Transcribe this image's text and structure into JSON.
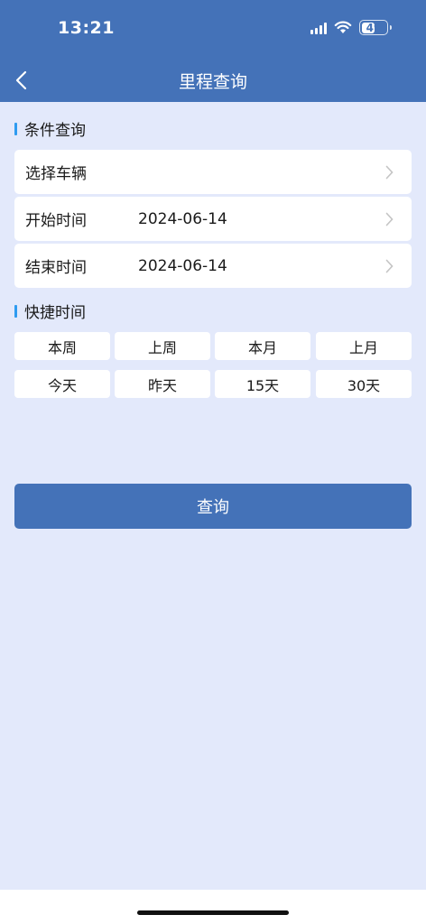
{
  "status_bar": {
    "time": "13:21",
    "battery": "49"
  },
  "nav": {
    "title": "里程查询"
  },
  "conditions": {
    "section_title": "条件查询",
    "vehicle_label": "选择车辆",
    "start_label": "开始时间",
    "start_value": "2024-06-14",
    "end_label": "结束时间",
    "end_value": "2024-06-14"
  },
  "quick": {
    "section_title": "快捷时间",
    "buttons": [
      "本周",
      "上周",
      "本月",
      "上月",
      "今天",
      "昨天",
      "15天",
      "30天"
    ]
  },
  "actions": {
    "query_label": "查询"
  },
  "colors": {
    "primary": "#4472b8",
    "background": "#e3e9fb",
    "accent": "#2f9bf0"
  }
}
